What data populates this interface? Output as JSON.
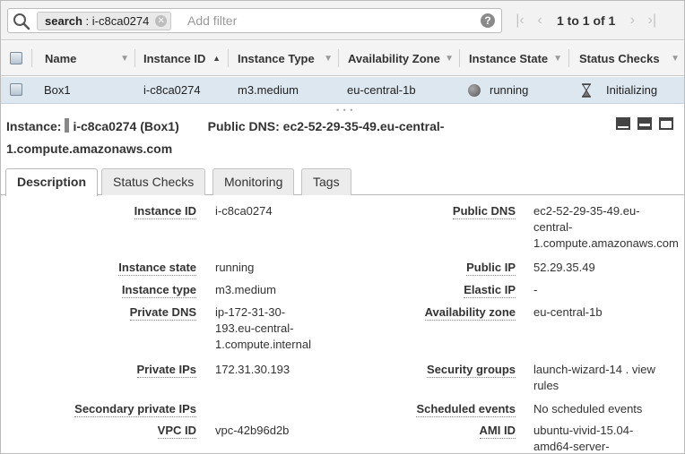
{
  "filter": {
    "chip_key": "search",
    "chip_sep": " : ",
    "chip_value": "i-c8ca0274",
    "placeholder": "Add filter",
    "pager_text": "1 to 1 of 1"
  },
  "columns": [
    "Name",
    "Instance ID",
    "Instance Type",
    "Availability Zone",
    "Instance State",
    "Status Checks"
  ],
  "row": {
    "name": "Box1",
    "instance_id": "i-c8ca0274",
    "instance_type": "m3.medium",
    "availability_zone": "eu-central-1b",
    "instance_state": "running",
    "status_checks": "Initializing"
  },
  "detail": {
    "instance_label": "Instance:",
    "instance_value": "i-c8ca0274 (Box1)",
    "dns_label": "Public DNS:",
    "dns_value_1": "ec2-52-29-35-49.eu-central-",
    "dns_value_2": "1.compute.amazonaws.com"
  },
  "tabs": [
    "Description",
    "Status Checks",
    "Monitoring",
    "Tags"
  ],
  "description": {
    "left": [
      {
        "label": "Instance ID",
        "lines": [
          "i-c8ca0274"
        ]
      },
      {
        "label": "Instance state",
        "lines": [
          "running"
        ]
      },
      {
        "label": "Instance type",
        "lines": [
          "m3.medium"
        ]
      },
      {
        "label": "Private DNS",
        "lines": [
          "ip-172-31-30-",
          "193.eu-central-",
          "1.compute.internal"
        ]
      },
      {
        "label": "Private IPs",
        "lines": [
          "172.31.30.193"
        ]
      },
      {
        "label": "Secondary private IPs",
        "lines": []
      },
      {
        "label": "VPC ID",
        "lines": [
          "vpc-42b96d2b"
        ]
      }
    ],
    "right": [
      {
        "label": "Public DNS",
        "lines": [
          "ec2-52-29-35-49.eu-",
          "central-",
          "1.compute.amazonaws.com"
        ]
      },
      {
        "label": "Public IP",
        "lines": [
          "52.29.35.49"
        ]
      },
      {
        "label": "Elastic IP",
        "lines": [
          "-"
        ]
      },
      {
        "label": "Availability zone",
        "lines": [
          "eu-central-1b"
        ]
      },
      {
        "label": "Security groups",
        "lines": [
          "launch-wizard-14 . view",
          "rules"
        ]
      },
      {
        "label": "Scheduled events",
        "lines": [
          "No scheduled events"
        ]
      },
      {
        "label": "AMI ID",
        "lines": [
          "ubuntu-vivid-15.04-",
          "amd64-server-"
        ]
      }
    ]
  }
}
